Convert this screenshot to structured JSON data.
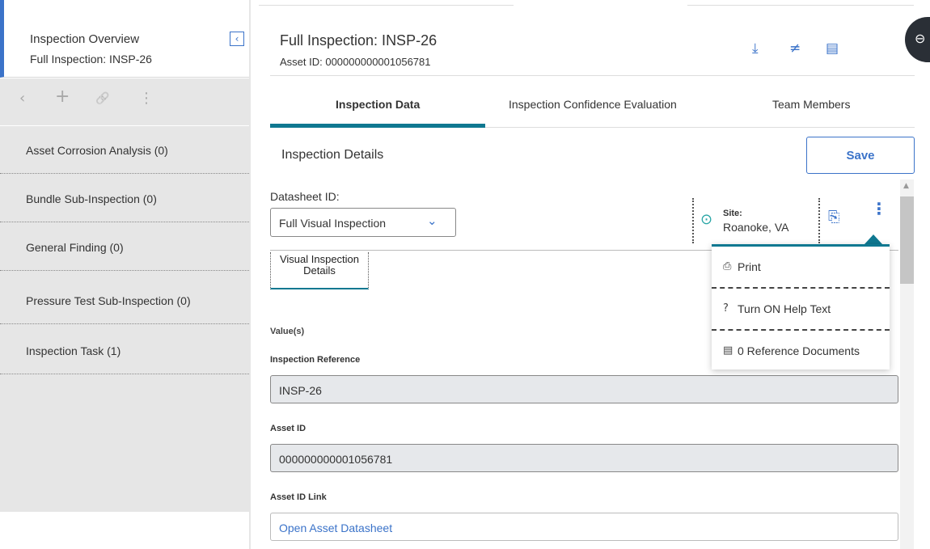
{
  "sidebar": {
    "title": "Inspection Overview",
    "subtitle": "Full Inspection: INSP-26",
    "collapse_icon": "‹",
    "toolbar": {
      "back": "‹",
      "add": "+",
      "link": "🔗",
      "more": "⋮"
    },
    "items": [
      {
        "label": "Asset Corrosion Analysis (0)"
      },
      {
        "label": "Bundle Sub-Inspection (0)"
      },
      {
        "label": "General Finding (0)"
      },
      {
        "label": "Pressure Test Sub-Inspection (0)"
      },
      {
        "label": "Inspection Task (1)"
      }
    ]
  },
  "header": {
    "title": "Full Inspection: INSP-26",
    "subtitle": "Asset ID: 000000000001056781",
    "icons": {
      "download": "⤓",
      "compare": "≠",
      "clipboard": "▤"
    },
    "side_tab_icon": "⊖"
  },
  "tabs": [
    {
      "label": "Inspection Data",
      "active": true
    },
    {
      "label": "Inspection Confidence Evaluation",
      "active": false
    },
    {
      "label": "Team Members",
      "active": false
    }
  ],
  "section": {
    "title": "Inspection Details",
    "save_label": "Save"
  },
  "datasheet": {
    "label": "Datasheet ID:",
    "value": "Full Visual Inspection",
    "chevron": "⌄"
  },
  "site": {
    "pin_icon": "⊙",
    "label": "Site:",
    "value": "Roanoke, VA"
  },
  "toolbar_right": {
    "copy_icon": "⎘",
    "more_icon": "⋮"
  },
  "sub_tab": {
    "label": "Visual Inspection Details"
  },
  "values_header": "Value(s)",
  "fields": [
    {
      "label": "Inspection Reference",
      "value": "INSP-26"
    },
    {
      "label": "Asset ID",
      "value": "000000000001056781"
    },
    {
      "label": "Asset ID Link",
      "value": "Open Asset Datasheet"
    }
  ],
  "menu": {
    "items": [
      {
        "icon": "⎙",
        "label": "Print"
      },
      {
        "icon": "?",
        "label": "Turn ON Help Text"
      },
      {
        "icon": "▤",
        "label": "0 Reference Documents"
      }
    ]
  },
  "colors": {
    "accent": "#3b73c9",
    "teal": "#0f7891",
    "sidebar_bg": "#e6e6e6"
  }
}
